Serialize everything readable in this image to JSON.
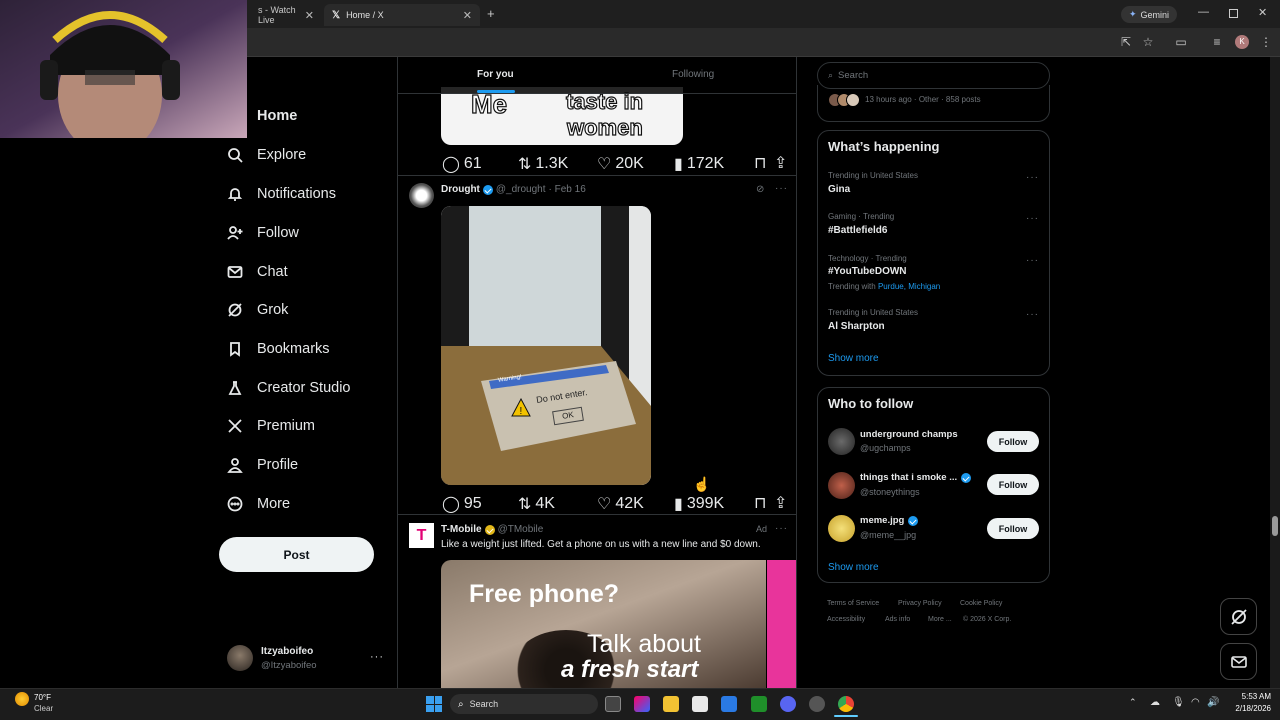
{
  "browser": {
    "tabs": [
      {
        "title": "s - Watch Live",
        "active": false
      },
      {
        "title": "Home / X",
        "active": true
      }
    ],
    "gemini_label": "Gemini"
  },
  "nav": {
    "items": [
      {
        "label": "Home",
        "icon": "home-icon"
      },
      {
        "label": "Explore",
        "icon": "search-icon"
      },
      {
        "label": "Notifications",
        "icon": "bell-icon"
      },
      {
        "label": "Follow",
        "icon": "add-user-icon"
      },
      {
        "label": "Chat",
        "icon": "mail-icon"
      },
      {
        "label": "Grok",
        "icon": "grok-icon"
      },
      {
        "label": "Bookmarks",
        "icon": "bookmark-icon"
      },
      {
        "label": "Creator Studio",
        "icon": "flask-icon"
      },
      {
        "label": "Premium",
        "icon": "x-logo-icon"
      },
      {
        "label": "Profile",
        "icon": "person-icon"
      },
      {
        "label": "More",
        "icon": "more-circle-icon"
      }
    ],
    "post_label": "Post",
    "account": {
      "name": "Itzyaboifeo",
      "handle": "@Itzyaboifeo"
    }
  },
  "feed": {
    "tabs": {
      "for_you": "For you",
      "following": "Following"
    },
    "prev_post": {
      "image_text": [
        "Me",
        "taste in",
        "women"
      ],
      "stats": {
        "replies": "61",
        "reposts": "1.3K",
        "likes": "20K",
        "views": "172K"
      }
    },
    "post": {
      "author": "Drought",
      "handle": "@_drought",
      "date": "· Feb 16",
      "mat_text": {
        "title": "Warning!",
        "message": "Do not enter.",
        "button": "OK"
      },
      "stats": {
        "replies": "95",
        "reposts": "4K",
        "likes": "42K",
        "views": "399K"
      }
    },
    "ad": {
      "author": "T-Mobile",
      "handle": "@TMobile",
      "ad_label": "Ad",
      "text": "Like a weight just lifted. Get a phone on us with a new line and $0 down.",
      "image_headline": "Free phone?",
      "image_line1": "Talk about",
      "image_line2": "a fresh start"
    }
  },
  "sidebar": {
    "search_placeholder": "Search",
    "top_meta": "13 hours ago · Other · 858 posts",
    "whats_happening": {
      "title": "What’s happening",
      "trends": [
        {
          "meta": "Trending in United States",
          "name": "Gina"
        },
        {
          "meta": "Gaming · Trending",
          "name": "#Battlefield6"
        },
        {
          "meta": "Technology · Trending",
          "name": "#YouTubeDOWN",
          "extra_prefix": "Trending with ",
          "extra_links": "Purdue, Michigan"
        },
        {
          "meta": "Trending in United States",
          "name": "Al Sharpton"
        }
      ],
      "show_more": "Show more"
    },
    "who_to_follow": {
      "title": "Who to follow",
      "accounts": [
        {
          "name": "underground champs",
          "handle": "@ugchamps",
          "button": "Follow"
        },
        {
          "name": "things that i smoke ...",
          "handle": "@stoneythings",
          "button": "Follow"
        },
        {
          "name": "meme.jpg",
          "handle": "@meme__jpg",
          "button": "Follow"
        }
      ],
      "show_more": "Show more"
    },
    "footer": {
      "links": [
        "Terms of Service",
        "Privacy Policy",
        "Cookie Policy",
        "Accessibility",
        "Ads info",
        "More ...",
        "© 2026 X Corp."
      ]
    }
  },
  "taskbar": {
    "weather_temp": "70°F",
    "weather_desc": "Clear",
    "search_label": "Search",
    "time": "5:53 AM",
    "date": "2/18/2026"
  }
}
